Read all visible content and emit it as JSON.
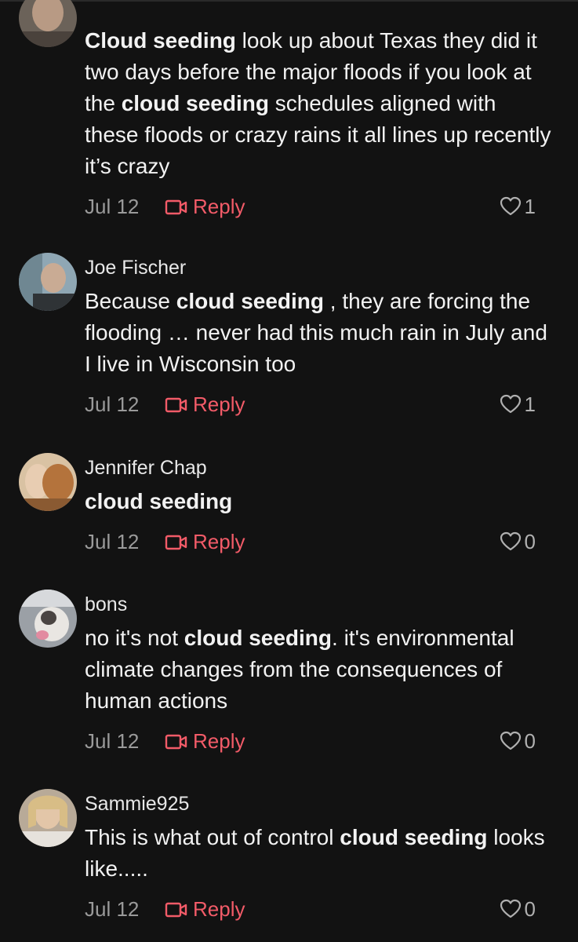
{
  "comments": [
    {
      "username": "",
      "segments": [
        {
          "t": "Cloud seeding",
          "b": true
        },
        {
          "t": " look up about Texas they did it two days before the major floods if you look at the ",
          "b": false
        },
        {
          "t": "cloud seeding",
          "b": true
        },
        {
          "t": " schedules aligned with these floods or crazy rains it all lines up recently it’s crazy",
          "b": false
        }
      ],
      "date": "Jul 12",
      "reply_label": "Reply",
      "likes": "1"
    },
    {
      "username": "Joe Fischer",
      "segments": [
        {
          "t": "Because ",
          "b": false
        },
        {
          "t": "cloud seeding",
          "b": true
        },
        {
          "t": " , they are forcing the flooding … never had this much rain in July and I live in Wisconsin too",
          "b": false
        }
      ],
      "date": "Jul 12",
      "reply_label": "Reply",
      "likes": "1"
    },
    {
      "username": "Jennifer Chap",
      "segments": [
        {
          "t": "cloud seeding",
          "b": true
        }
      ],
      "date": "Jul 12",
      "reply_label": "Reply",
      "likes": "0"
    },
    {
      "username": "bons",
      "segments": [
        {
          "t": "no it's not ",
          "b": false
        },
        {
          "t": "cloud seeding",
          "b": true
        },
        {
          "t": ". it's environmental climate changes from the consequences of human actions",
          "b": false
        }
      ],
      "date": "Jul 12",
      "reply_label": "Reply",
      "likes": "0"
    },
    {
      "username": "Sammie925",
      "segments": [
        {
          "t": "This is what out of control ",
          "b": false
        },
        {
          "t": "cloud seeding",
          "b": true
        },
        {
          "t": " looks like.....",
          "b": false
        }
      ],
      "date": "Jul 12",
      "reply_label": "Reply",
      "likes": "0"
    }
  ],
  "icons": {
    "reply": "video-reply-icon",
    "like": "heart-icon"
  },
  "colors": {
    "background": "#121212",
    "reply": "#f25b68",
    "date": "#9a9a9a"
  }
}
